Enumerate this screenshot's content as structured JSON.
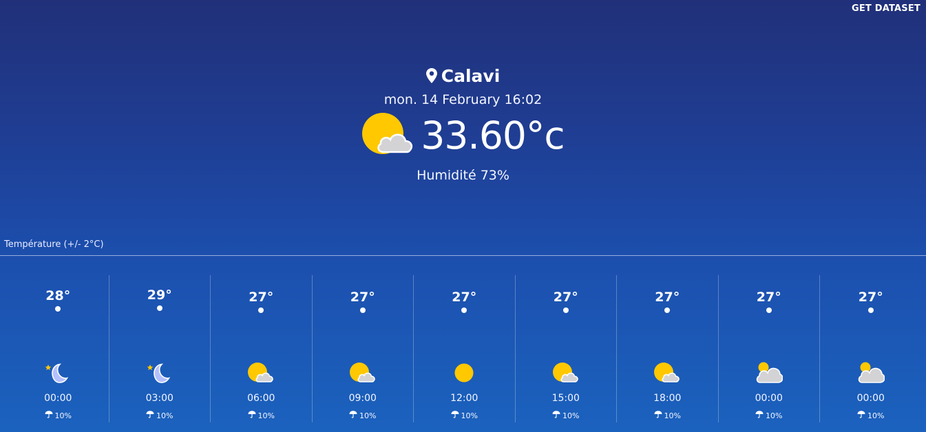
{
  "header": {
    "get_dataset_label": "GET DATASET"
  },
  "current": {
    "location": "Calavi",
    "datetime": "mon. 14 February 16:02",
    "temperature": "33.60°c",
    "humidity": "Humidité 73%",
    "icon": "partly-cloudy-icon"
  },
  "forecast": {
    "label": "Température (+/- 2°C)",
    "hours": [
      {
        "temp": "28°",
        "time": "00:00",
        "rain": "10%",
        "icon": "moon-icon",
        "level": 0.68
      },
      {
        "temp": "29°",
        "time": "03:00",
        "rain": "10%",
        "icon": "moon-icon",
        "level": 1.0
      },
      {
        "temp": "27°",
        "time": "06:00",
        "rain": "10%",
        "icon": "sun-cloud-icon",
        "level": 0.35
      },
      {
        "temp": "27°",
        "time": "09:00",
        "rain": "10%",
        "icon": "sun-cloud-icon",
        "level": 0.35
      },
      {
        "temp": "27°",
        "time": "12:00",
        "rain": "10%",
        "icon": "sun-icon",
        "level": 0.35
      },
      {
        "temp": "27°",
        "time": "15:00",
        "rain": "10%",
        "icon": "sun-cloud-icon",
        "level": 0.35
      },
      {
        "temp": "27°",
        "time": "18:00",
        "rain": "10%",
        "icon": "sun-cloud-icon",
        "level": 0.35
      },
      {
        "temp": "27°",
        "time": "00:00",
        "rain": "10%",
        "icon": "cloud-sun-icon",
        "level": 0.35
      },
      {
        "temp": "27°",
        "time": "00:00",
        "rain": "10%",
        "icon": "cloud-sun-icon",
        "level": 0.35
      }
    ]
  },
  "colors": {
    "background_top": "#213079",
    "background_bottom": "#1b62be",
    "sun": "#ffc800",
    "cloud": "#d3d3d6",
    "moon": "#b4c0ff"
  }
}
